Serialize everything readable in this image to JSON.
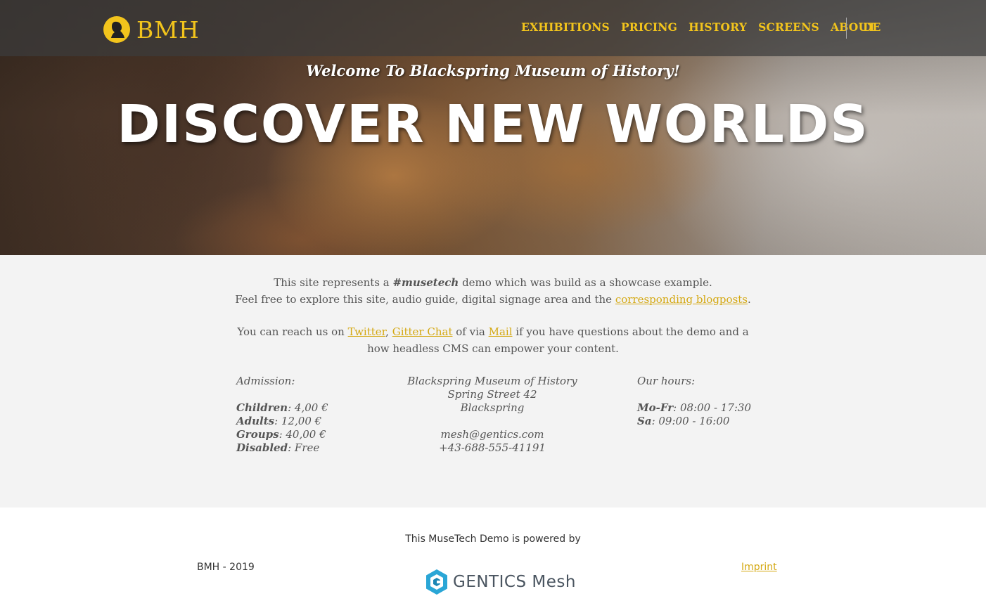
{
  "colors": {
    "accent": "#f2c41c",
    "link": "#d4a812",
    "nav_bg": "#3c3c3c",
    "content_bg": "#f3f3f3"
  },
  "brand": {
    "text": "BMH",
    "logo_icon": "bust-silhouette-icon"
  },
  "nav": {
    "items": [
      {
        "label": "EXHIBITIONS"
      },
      {
        "label": "PRICING"
      },
      {
        "label": "HISTORY"
      },
      {
        "label": "SCREENS"
      },
      {
        "label": "ABOUT"
      }
    ],
    "language": "DE"
  },
  "hero": {
    "welcome": "Welcome To Blackspring Museum of History!",
    "headline": "DISCOVER NEW WORLDS"
  },
  "intro": {
    "line1_pre": "This site represents a ",
    "line1_tag": "#musetech",
    "line1_post": " demo which was build as a showcase example.",
    "line2_pre": "Feel free to explore this site, audio guide, digital signage area and the ",
    "line2_link": "corresponding blogposts",
    "line2_post": ".",
    "reach_pre": "You can reach us on ",
    "reach_twitter": "Twitter",
    "reach_comma": ",",
    "reach_gitter": "Gitter Chat",
    "reach_mid": " of via ",
    "reach_mail": "Mail",
    "reach_post": " if you have questions about the demo and a how headless CMS can empower your content."
  },
  "admission": {
    "heading": "Admission:",
    "rows": [
      {
        "label": "Children",
        "value": ": 4,00 €"
      },
      {
        "label": "Adults",
        "value": ": 12,00 €"
      },
      {
        "label": "Groups",
        "value": ": 40,00 €"
      },
      {
        "label": "Disabled",
        "value": ": Free"
      }
    ]
  },
  "address": {
    "name": "Blackspring Museum of History",
    "street": "Spring Street 42",
    "city": "Blackspring",
    "email": "mesh@gentics.com",
    "phone": "+43-688-555-41191"
  },
  "hours": {
    "heading": "Our hours:",
    "rows": [
      {
        "label": "Mo-Fr",
        "value": ": 08:00 - 17:30"
      },
      {
        "label": "Sa",
        "value": ": 09:00 - 16:00"
      }
    ]
  },
  "footer": {
    "powered": "This MuseTech Demo is powered by",
    "copyright": "BMH - 2019",
    "imprint": "Imprint",
    "mesh_logo_text": "GENTICS Mesh"
  }
}
